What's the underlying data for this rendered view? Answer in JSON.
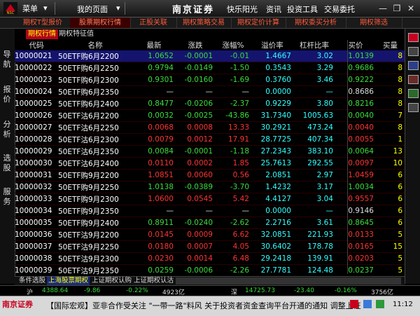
{
  "titlebar": {
    "menu": "菜单",
    "my_page": "我的页面",
    "brand": "南京证券",
    "user": "快乐阳光",
    "news": "资讯",
    "tools": "投资工具",
    "trade": "交易委托"
  },
  "tabs": [
    "期权T型报价",
    "股票期权行情",
    "正股关联",
    "期权策略交易",
    "期权定价计算",
    "期权委买分析",
    "期权筛选"
  ],
  "active_tab": 1,
  "sidebar": [
    "导航",
    "报价",
    "分析",
    "选股",
    "服务"
  ],
  "subtabs": [
    "期权行情",
    "期权特征值"
  ],
  "columns": [
    "代码",
    "名称",
    "最新",
    "涨跌",
    "涨幅%",
    "溢价率",
    "杠杆比率",
    "买价",
    "买量"
  ],
  "rows": [
    {
      "code": "10000021",
      "name": "50ETF购6月2200",
      "last": "1.0652",
      "chg": "-0.0001",
      "pct": "-0.01",
      "prem": "1.4667",
      "lev": "3.02",
      "bid": "1.0139",
      "vol": "8"
    },
    {
      "code": "10000022",
      "name": "50ETF购6月2250",
      "last": "0.9794",
      "chg": "-0.0149",
      "pct": "-1.50",
      "prem": "0.3543",
      "lev": "3.29",
      "bid": "0.9686",
      "vol": "8"
    },
    {
      "code": "10000023",
      "name": "50ETF购6月2300",
      "last": "0.9301",
      "chg": "-0.0160",
      "pct": "-1.69",
      "prem": "0.3760",
      "lev": "3.46",
      "bid": "0.9222",
      "vol": "8"
    },
    {
      "code": "10000024",
      "name": "50ETF购6月2350",
      "last": "—",
      "chg": "—",
      "pct": "—",
      "prem": "0.0000",
      "lev": "—",
      "bid": "0.8686",
      "vol": "8"
    },
    {
      "code": "10000025",
      "name": "50ETF购6月2400",
      "last": "0.8477",
      "chg": "-0.0206",
      "pct": "-2.37",
      "prem": "0.9229",
      "lev": "3.80",
      "bid": "0.8216",
      "vol": "8"
    },
    {
      "code": "10000026",
      "name": "50ETF沽6月2200",
      "last": "0.0032",
      "chg": "-0.0025",
      "pct": "-43.86",
      "prem": "31.7340",
      "lev": "1005.63",
      "bid": "0.0040",
      "vol": "7"
    },
    {
      "code": "10000027",
      "name": "50ETF沽6月2250",
      "last": "0.0068",
      "chg": "0.0008",
      "pct": "13.33",
      "prem": "30.2921",
      "lev": "473.24",
      "bid": "0.0040",
      "vol": "8"
    },
    {
      "code": "10000028",
      "name": "50ETF沽6月2300",
      "last": "0.0079",
      "chg": "0.0012",
      "pct": "17.91",
      "prem": "28.7725",
      "lev": "407.34",
      "bid": "0.0055",
      "vol": "1"
    },
    {
      "code": "10000029",
      "name": "50ETF沽6月2350",
      "last": "0.0084",
      "chg": "-0.0001",
      "pct": "-1.18",
      "prem": "27.2343",
      "lev": "383.10",
      "bid": "0.0064",
      "vol": "13"
    },
    {
      "code": "10000030",
      "name": "50ETF沽6月2400",
      "last": "0.0110",
      "chg": "0.0002",
      "pct": "1.85",
      "prem": "25.7613",
      "lev": "292.55",
      "bid": "0.0097",
      "vol": "10"
    },
    {
      "code": "10000031",
      "name": "50ETF购9月2200",
      "last": "1.0851",
      "chg": "0.0060",
      "pct": "0.56",
      "prem": "2.0851",
      "lev": "2.97",
      "bid": "1.0459",
      "vol": "6"
    },
    {
      "code": "10000032",
      "name": "50ETF购9月2250",
      "last": "1.0138",
      "chg": "-0.0389",
      "pct": "-3.70",
      "prem": "1.4232",
      "lev": "3.17",
      "bid": "1.0034",
      "vol": "6"
    },
    {
      "code": "10000033",
      "name": "50ETF购9月2300",
      "last": "1.0600",
      "chg": "0.0545",
      "pct": "5.42",
      "prem": "4.4127",
      "lev": "3.04",
      "bid": "0.9557",
      "vol": "6"
    },
    {
      "code": "10000034",
      "name": "50ETF购9月2350",
      "last": "—",
      "chg": "—",
      "pct": "—",
      "prem": "0.0000",
      "lev": "—",
      "bid": "0.9146",
      "vol": "6"
    },
    {
      "code": "10000035",
      "name": "50ETF购9月2400",
      "last": "0.8911",
      "chg": "-0.0240",
      "pct": "-2.62",
      "prem": "2.2716",
      "lev": "3.61",
      "bid": "0.8645",
      "vol": "6"
    },
    {
      "code": "10000036",
      "name": "50ETF沽9月2200",
      "last": "0.0145",
      "chg": "0.0009",
      "pct": "6.62",
      "prem": "32.0851",
      "lev": "221.93",
      "bid": "0.0133",
      "vol": "5"
    },
    {
      "code": "10000037",
      "name": "50ETF沽9月2250",
      "last": "0.0180",
      "chg": "0.0007",
      "pct": "4.05",
      "prem": "30.6402",
      "lev": "178.78",
      "bid": "0.0165",
      "vol": "15"
    },
    {
      "code": "10000038",
      "name": "50ETF沽9月2300",
      "last": "0.0230",
      "chg": "0.0014",
      "pct": "6.48",
      "prem": "29.2418",
      "lev": "139.91",
      "bid": "0.0203",
      "vol": "5"
    },
    {
      "code": "10000039",
      "name": "50ETF沽9月2350",
      "last": "0.0259",
      "chg": "-0.0006",
      "pct": "-2.26",
      "prem": "27.7781",
      "lev": "124.48",
      "bid": "0.0237",
      "vol": "5"
    }
  ],
  "bottom_tabs": [
    "条件选股",
    "上海股票期权",
    "上证期权认购",
    "上证期权认沽"
  ],
  "active_bottom_tab": 1,
  "index_bar": {
    "sh_label": "沪",
    "sh_value": "4388.64",
    "sh_chg": "-9.86",
    "sh_pct": "-0.22%",
    "sh_amount": "4923亿",
    "sz_label": "深",
    "sz_value": "14725.73",
    "sz_chg": "-23.40",
    "sz_pct": "-0.16%",
    "sz_amount": "3756亿"
  },
  "status": {
    "logo": "南京证券",
    "ticker": "【国际宏观】亚非合作受关注 \"一带一路\"料风 关于投资者资金查询平台开通的通知   调整上证",
    "time": "11:12"
  },
  "colors": {
    "up": "#ff3333",
    "down": "#3cdc3c",
    "selected_row": "#14146e",
    "accent_tab": "#b3001a"
  }
}
